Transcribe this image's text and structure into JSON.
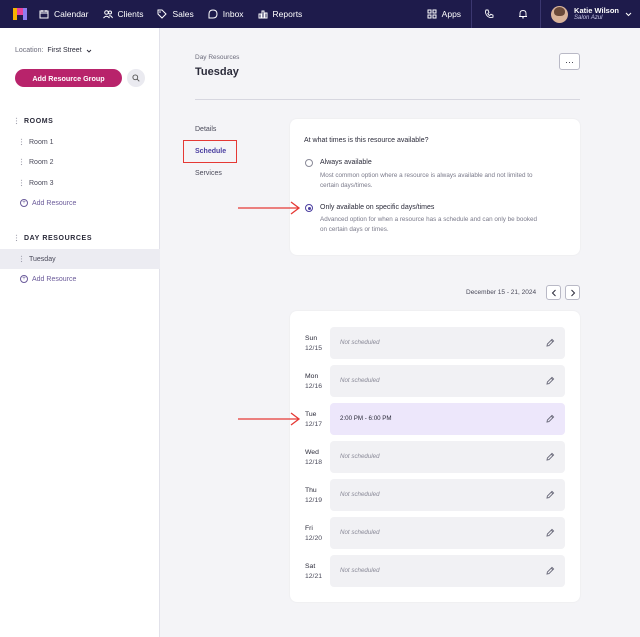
{
  "nav": {
    "items": [
      {
        "label": "Calendar",
        "icon": "calendar-icon"
      },
      {
        "label": "Clients",
        "icon": "users-icon"
      },
      {
        "label": "Sales",
        "icon": "tag-icon"
      },
      {
        "label": "Inbox",
        "icon": "chat-icon"
      },
      {
        "label": "Reports",
        "icon": "bar-chart-icon"
      }
    ],
    "apps_label": "Apps",
    "user_name": "Katie Wilson",
    "user_salon": "Salon Azul"
  },
  "sidebar": {
    "location_label": "Location:",
    "location_value": "First Street",
    "add_group_label": "Add Resource Group",
    "rooms_title": "ROOMS",
    "rooms": [
      "Room 1",
      "Room 2",
      "Room 3"
    ],
    "add_resource_label": "Add Resource",
    "day_title": "DAY RESOURCES",
    "day_items": [
      "Tuesday"
    ],
    "add_resource_label_2": "Add Resource"
  },
  "main": {
    "crumb": "Day Resources",
    "title": "Tuesday",
    "more_label": "···",
    "tabs": [
      "Details",
      "Schedule",
      "Services"
    ],
    "availability": {
      "question": "At what times is this resource available?",
      "options": [
        {
          "title": "Always available",
          "desc": "Most common option where a resource is always available and not limited to certain days/times.",
          "selected": false
        },
        {
          "title": "Only available on specific days/times",
          "desc": "Advanced option for when a resource has a schedule and can only be booked on certain days or times.",
          "selected": true
        }
      ]
    },
    "range": "December 15 - 21, 2024",
    "days": [
      {
        "day": "Sun",
        "date": "12/15",
        "slot": "Not scheduled",
        "active": false
      },
      {
        "day": "Mon",
        "date": "12/16",
        "slot": "Not scheduled",
        "active": false
      },
      {
        "day": "Tue",
        "date": "12/17",
        "slot": "2:00 PM - 6:00 PM",
        "active": true
      },
      {
        "day": "Wed",
        "date": "12/18",
        "slot": "Not scheduled",
        "active": false
      },
      {
        "day": "Thu",
        "date": "12/19",
        "slot": "Not scheduled",
        "active": false
      },
      {
        "day": "Fri",
        "date": "12/20",
        "slot": "Not scheduled",
        "active": false
      },
      {
        "day": "Sat",
        "date": "12/21",
        "slot": "Not scheduled",
        "active": false
      }
    ]
  },
  "colors": {
    "nav_bg": "#1e1b4b",
    "primary": "#b8236b",
    "annotation": "#e53935",
    "active_slot": "#ede7fb"
  }
}
